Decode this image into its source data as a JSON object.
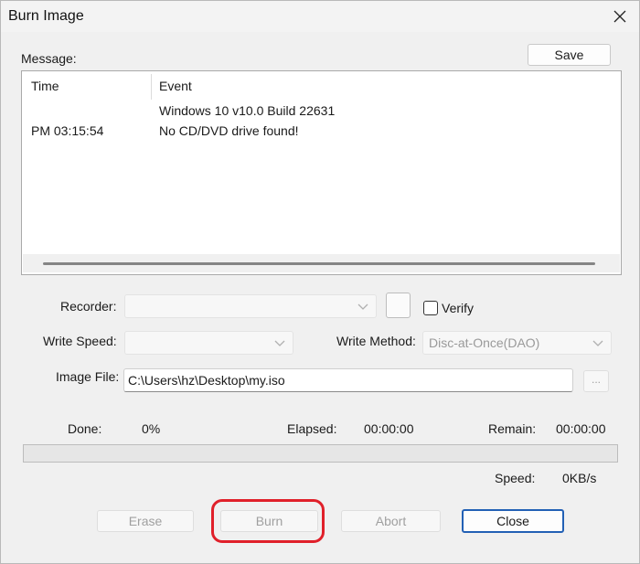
{
  "window": {
    "title": "Burn Image"
  },
  "message": {
    "label": "Message:",
    "save_label": "Save",
    "columns": {
      "time": "Time",
      "event": "Event"
    },
    "rows": [
      {
        "time": "",
        "event": "Windows 10 v10.0 Build 22631"
      },
      {
        "time": "PM 03:15:54",
        "event": "No CD/DVD drive found!"
      }
    ]
  },
  "recorder": {
    "label": "Recorder:",
    "value": ""
  },
  "verify": {
    "label": "Verify",
    "checked": false
  },
  "write_speed": {
    "label": "Write Speed:",
    "value": ""
  },
  "write_method": {
    "label": "Write Method:",
    "value": "Disc-at-Once(DAO)"
  },
  "image_file": {
    "label": "Image File:",
    "value": "C:\\Users\\hz\\Desktop\\my.iso",
    "browse_label": "..."
  },
  "status": {
    "done_label": "Done:",
    "done_value": "0%",
    "elapsed_label": "Elapsed:",
    "elapsed_value": "00:00:00",
    "remain_label": "Remain:",
    "remain_value": "00:00:00",
    "speed_label": "Speed:",
    "speed_value": "0KB/s",
    "progress_fraction": 0
  },
  "buttons": {
    "erase": "Erase",
    "burn": "Burn",
    "abort": "Abort",
    "close": "Close"
  },
  "colors": {
    "highlight": "#e0202a",
    "primary_border": "#2260b5"
  }
}
